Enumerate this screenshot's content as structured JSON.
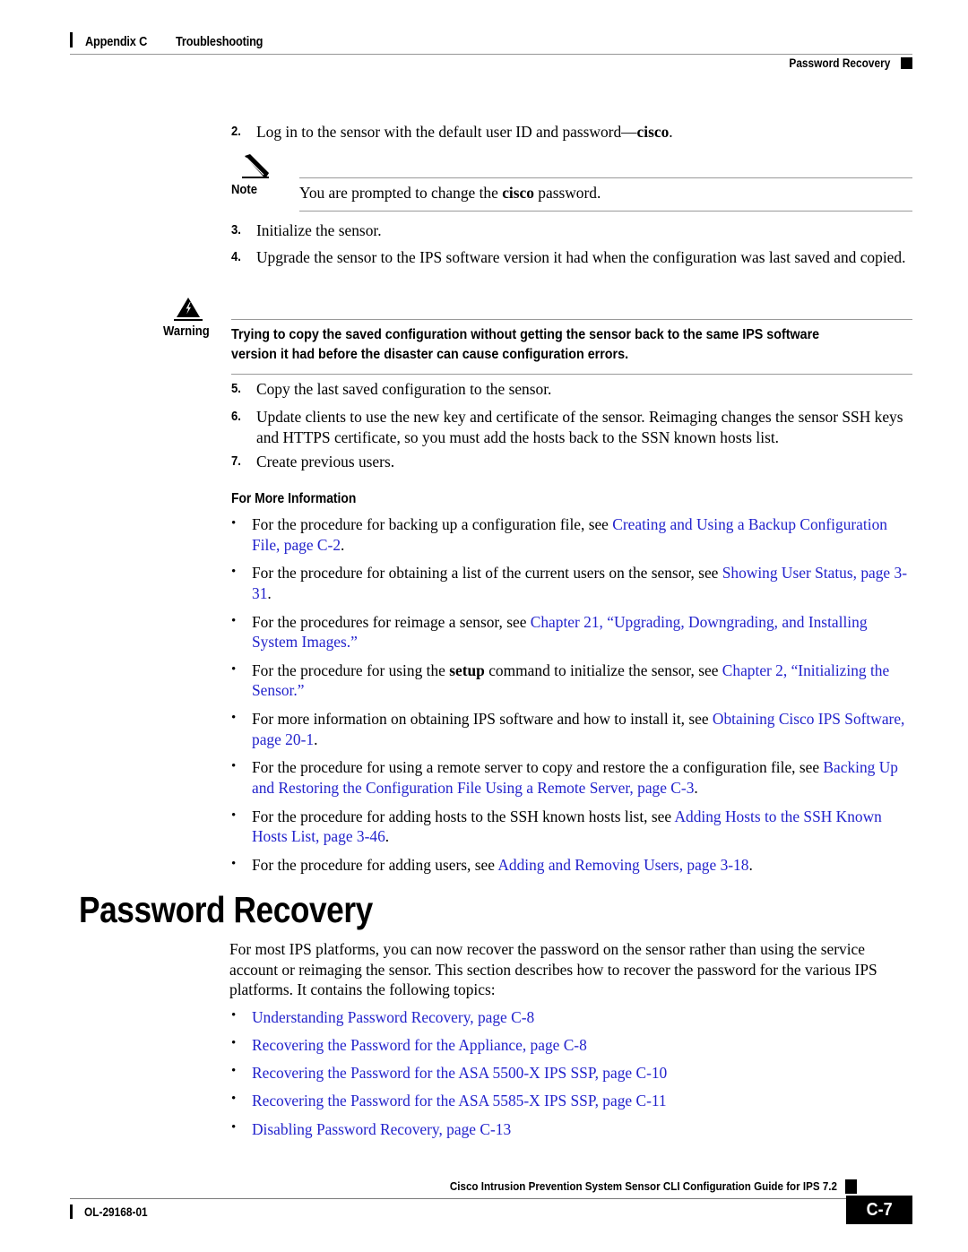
{
  "header": {
    "appendix": "Appendix C",
    "chapter_title": "Troubleshooting",
    "section": "Password Recovery"
  },
  "steps": [
    {
      "num": "2.",
      "text_parts": [
        {
          "t": "Log in to the sensor with the default user ID and password",
          "bold": false
        },
        {
          "t": "—",
          "bold": false
        },
        {
          "t": "cisco",
          "bold": true
        },
        {
          "t": ".",
          "bold": false
        }
      ]
    },
    {
      "num": "3.",
      "text_parts": [
        {
          "t": "Initialize the sensor.",
          "bold": false
        }
      ]
    },
    {
      "num": "4.",
      "text_parts": [
        {
          "t": "Upgrade the sensor to the IPS software version it had when the configuration was last saved and copied.",
          "bold": false
        }
      ]
    },
    {
      "num": "5.",
      "text_parts": [
        {
          "t": "Copy the last saved configuration to the sensor.",
          "bold": false
        }
      ]
    },
    {
      "num": "6.",
      "text_parts": [
        {
          "t": "Update clients to use the new key and certificate of the sensor. Reimaging changes the sensor SSH keys and HTTPS certificate, so you must add the hosts back to the SSN known hosts list.",
          "bold": false
        }
      ]
    },
    {
      "num": "7.",
      "text_parts": [
        {
          "t": "Create previous users.",
          "bold": false
        }
      ]
    }
  ],
  "note": {
    "label": "Note",
    "icon": "pencil-icon",
    "text_parts": [
      {
        "t": "You are prompted to change the ",
        "bold": false
      },
      {
        "t": "cisco",
        "bold": true
      },
      {
        "t": " password.",
        "bold": false
      }
    ]
  },
  "warning": {
    "label": "Warning",
    "icon": "warning-triangle-icon",
    "lines": [
      "Trying to copy the saved configuration without getting the sensor back to the same IPS software",
      "version it had before the disaster can cause configuration errors."
    ]
  },
  "for_more_information": {
    "heading": "For More Information",
    "bullet": "•",
    "items": [
      {
        "parts": [
          {
            "t": "For the procedure for backing up a configuration file, see ",
            "link": false
          },
          {
            "t": "Creating and Using a Backup Configuration File, page C-2",
            "link": true
          },
          {
            "t": ".",
            "link": false
          }
        ]
      },
      {
        "parts": [
          {
            "t": "For the procedure for obtaining a list of the current users on the sensor, see ",
            "link": false
          },
          {
            "t": "Showing User Status, page 3-31",
            "link": true
          },
          {
            "t": ".",
            "link": false
          }
        ]
      },
      {
        "parts": [
          {
            "t": "For the procedures for reimage a sensor, see ",
            "link": false
          },
          {
            "t": "Chapter 21, “Upgrading, Downgrading, and Installing System Images.”",
            "link": true
          }
        ]
      },
      {
        "parts": [
          {
            "t": "For the procedure for using the ",
            "link": false
          },
          {
            "t": "setup",
            "link": false,
            "bold": true
          },
          {
            "t": " command to initialize the sensor, see ",
            "link": false
          },
          {
            "t": "Chapter 2, “Initializing the Sensor.”",
            "link": true
          }
        ]
      },
      {
        "parts": [
          {
            "t": "For more information on obtaining IPS software and how to install it, see ",
            "link": false
          },
          {
            "t": "Obtaining Cisco IPS Software, page 20-1",
            "link": true
          },
          {
            "t": ".",
            "link": false
          }
        ]
      },
      {
        "parts": [
          {
            "t": "For the procedure for using a remote server to copy and restore the a configuration file, see ",
            "link": false
          },
          {
            "t": "Backing Up and Restoring the Configuration File Using a Remote Server, page C-3",
            "link": true
          },
          {
            "t": ".",
            "link": false
          }
        ]
      },
      {
        "parts": [
          {
            "t": "For the procedure for adding hosts to the SSH known hosts list, see ",
            "link": false
          },
          {
            "t": "Adding Hosts to the SSH Known Hosts List, page 3-46",
            "link": true
          },
          {
            "t": ".",
            "link": false
          }
        ]
      },
      {
        "parts": [
          {
            "t": "For the procedure for adding users, see ",
            "link": false
          },
          {
            "t": "Adding and Removing Users, page 3-18",
            "link": true
          },
          {
            "t": ".",
            "link": false
          }
        ]
      }
    ]
  },
  "section": {
    "title": "Password Recovery",
    "intro": "For most IPS platforms, you can now recover the password on the sensor rather than using the service account or reimaging the sensor. This section describes how to recover the password for the various IPS platforms. It contains the following topics:",
    "bullet": "•",
    "topics": [
      "Understanding Password Recovery, page C-8",
      "Recovering the Password for the Appliance, page C-8",
      "Recovering the Password for the ASA 5500-X IPS SSP, page C-10",
      "Recovering the Password for the ASA 5585-X IPS SSP, page C-11",
      "Disabling Password Recovery, page C-13"
    ]
  },
  "footer": {
    "doc_title": "Cisco Intrusion Prevention System Sensor CLI Configuration Guide for IPS 7.2",
    "doc_id": "OL-29168-01",
    "page_number": "C-7"
  },
  "colors": {
    "link": "#2323CC",
    "rule": "#9a9a9a",
    "text": "#000000"
  }
}
